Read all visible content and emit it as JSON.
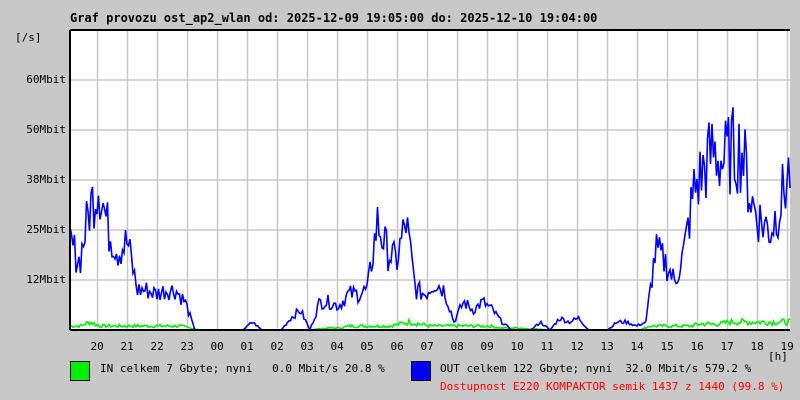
{
  "chart_data": {
    "type": "line",
    "title": "Graf provozu ost_ap2_wlan od: 2025-12-09 19:05:00 do: 2025-12-10 19:04:00",
    "ylabel": "[/s]",
    "xlabel": "[h]",
    "y_ticks": [
      {
        "v": 12.5,
        "label": "12Mbit"
      },
      {
        "v": 25,
        "label": "25Mbit"
      },
      {
        "v": 37.5,
        "label": "38Mbit"
      },
      {
        "v": 50,
        "label": "50Mbit"
      },
      {
        "v": 62.5,
        "label": "60Mbit"
      }
    ],
    "ylim": [
      0,
      75
    ],
    "x_ticks": [
      "20",
      "21",
      "22",
      "23",
      "00",
      "01",
      "02",
      "03",
      "04",
      "05",
      "06",
      "07",
      "08",
      "09",
      "10",
      "11",
      "12",
      "13",
      "14",
      "15",
      "16",
      "17",
      "18",
      "19"
    ],
    "x_step_minutes": 20,
    "series": [
      {
        "name": "IN",
        "color": "#00f000",
        "values": [
          1,
          1,
          2,
          1,
          1,
          1,
          1,
          1,
          1,
          1,
          1,
          1,
          0.5,
          0,
          0,
          0,
          0,
          0,
          0,
          0,
          0,
          0,
          0,
          0,
          0,
          0.3,
          0.5,
          0.5,
          1,
          1,
          1,
          1,
          1,
          1.5,
          2,
          1.5,
          1,
          1,
          1,
          1,
          1,
          1,
          1,
          0.5,
          0.5,
          0.5,
          0.3,
          0.2,
          0,
          0,
          0,
          0,
          0,
          0,
          0,
          0,
          0,
          0,
          1,
          1,
          1,
          1,
          1,
          1.5,
          1.5,
          1.5,
          2,
          2,
          2,
          2,
          2,
          2,
          2
        ]
      },
      {
        "name": "OUT",
        "color": "#0000ff",
        "values": [
          22,
          17,
          30,
          37,
          25,
          20,
          22,
          10,
          10,
          9,
          10,
          10,
          7,
          0,
          0,
          0,
          0,
          0,
          0,
          2,
          0,
          0,
          0,
          3,
          5,
          0,
          7,
          7,
          6,
          9,
          9,
          10,
          27,
          20,
          17,
          27,
          10,
          9,
          12,
          10,
          2,
          7,
          5,
          7,
          5,
          2,
          0,
          0,
          0,
          2,
          0,
          3,
          2,
          3,
          0,
          0,
          0,
          2,
          2,
          1,
          2,
          20,
          17,
          12,
          20,
          35,
          40,
          45,
          42,
          45,
          45,
          32,
          27,
          25,
          32,
          40
        ]
      }
    ]
  },
  "legend": {
    "in_text": "IN celkem 7 Gbyte; nyní   0.0 Mbit/s 20.8 %",
    "out_text": "OUT celkem 122 Gbyte; nyní  32.0 Mbit/s 579.2 %",
    "availability": "Dostupnost E220 KOMPAKTOR semik 1437 z 1440 (99.8 %)",
    "in_color": "#00f000",
    "out_color": "#0000ff",
    "availability_color": "#ff0000"
  }
}
